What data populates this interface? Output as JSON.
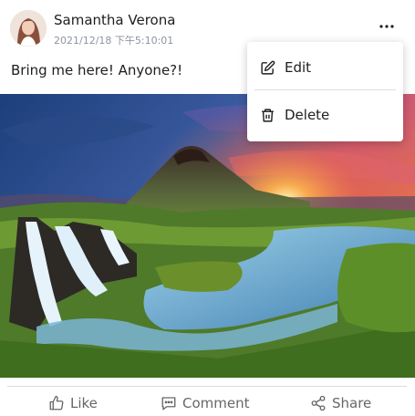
{
  "post": {
    "author": "Samantha Verona",
    "timestamp": "2021/12/18 下午5:10:01",
    "text": "Bring me here! Anyone?!"
  },
  "menu": {
    "items": [
      {
        "label": "Edit",
        "icon": "edit-icon"
      },
      {
        "label": "Delete",
        "icon": "trash-icon"
      }
    ]
  },
  "actions": [
    {
      "label": "Like",
      "icon": "thumbs-up-icon"
    },
    {
      "label": "Comment",
      "icon": "comment-icon"
    },
    {
      "label": "Share",
      "icon": "share-icon"
    }
  ],
  "colors": {
    "text": "#1c1e21",
    "muted": "#65676b",
    "timestamp": "#8d949e",
    "divider": "#dadde1"
  }
}
